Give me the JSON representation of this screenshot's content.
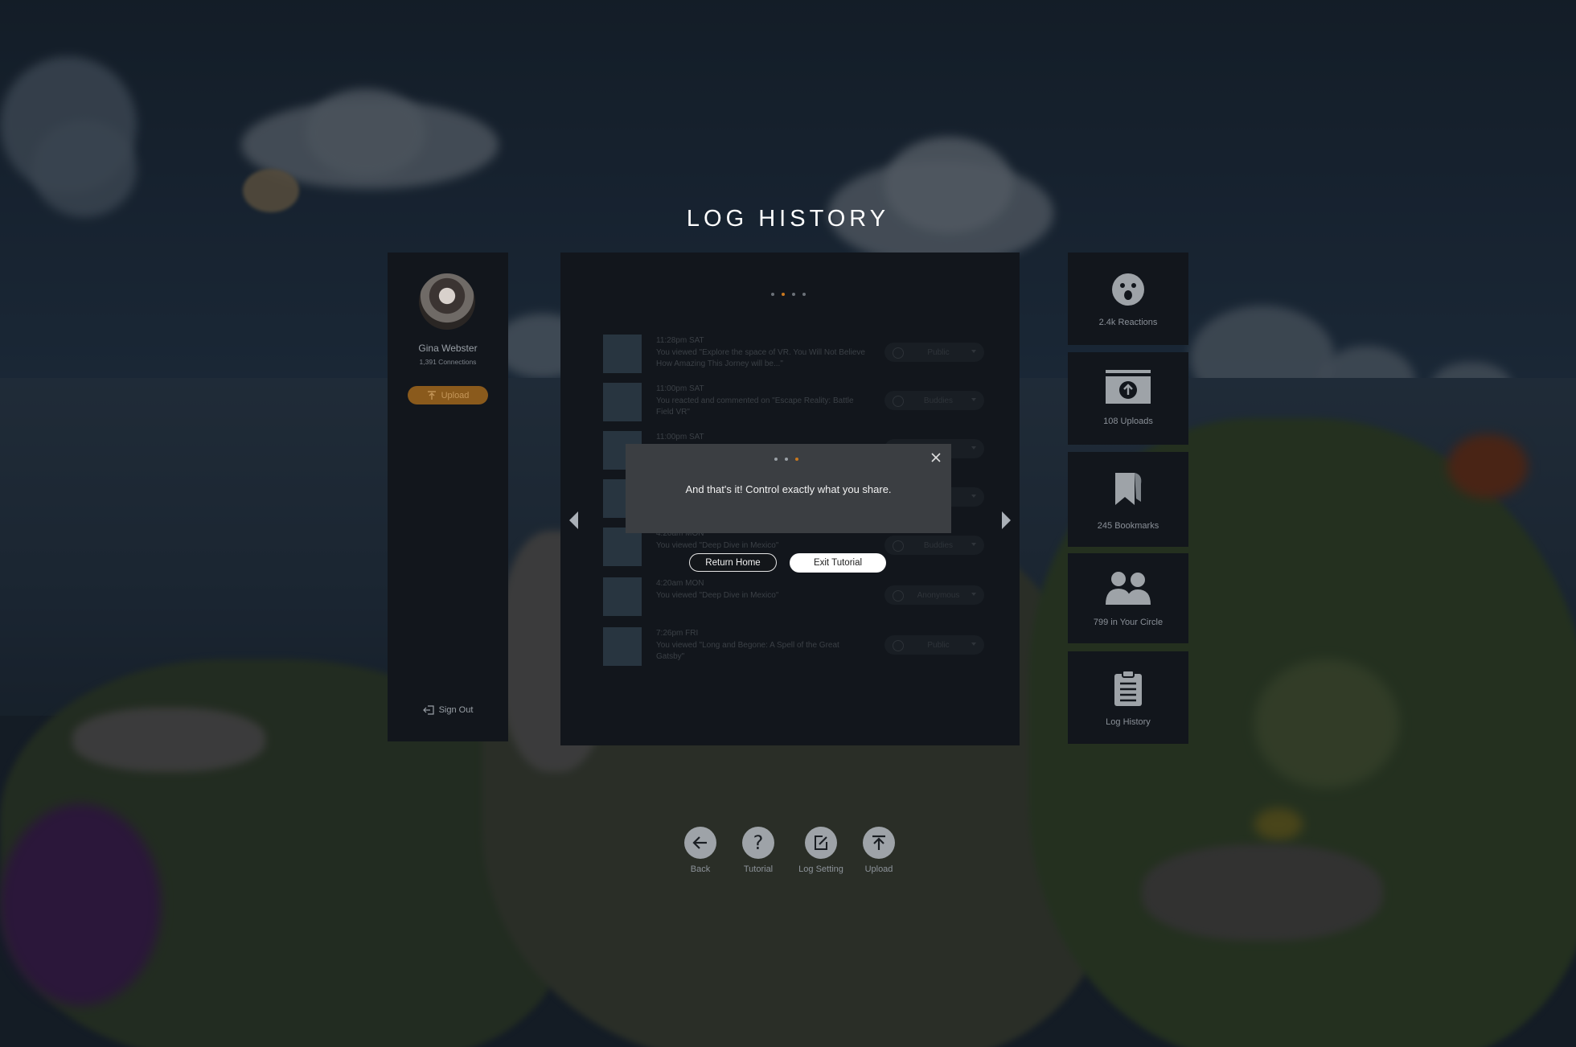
{
  "title": "LOG HISTORY",
  "profile": {
    "name": "Gina Webster",
    "connections": "1,391 Connections",
    "upload_label": "Upload",
    "signout_label": "Sign Out"
  },
  "log_entries": [
    {
      "time": "11:28pm SAT",
      "text": "You viewed \"Explore the space of VR. You Will Not Believe How Amazing This Jorney will be...\"",
      "privacy": "Public"
    },
    {
      "time": "11:00pm SAT",
      "text": "You reacted and commented on \"Escape Reality: Battle Field VR\"",
      "privacy": "Buddies"
    },
    {
      "time": "11:00pm SAT",
      "text": "",
      "privacy": "...us"
    },
    {
      "time": "",
      "text": "",
      "privacy": ""
    },
    {
      "time": "4:20am MON",
      "text": "You viewed \"Deep Dive in Mexico\"",
      "privacy": "Buddies"
    },
    {
      "time": "4:20am MON",
      "text": "You viewed \"Deep Dive in Mexico\"",
      "privacy": "Anonymous"
    },
    {
      "time": "7:26pm FRI",
      "text": "You viewed \"Long and Begone: A Spell of the Great Gatsby\"",
      "privacy": "Public"
    }
  ],
  "tutorial": {
    "message": "And that's it! Control exactly what you share.",
    "return_label": "Return Home",
    "exit_label": "Exit Tutorial",
    "step_total": 3,
    "step_current": 3
  },
  "panel_page": {
    "total": 4,
    "current": 2
  },
  "stats": [
    {
      "label": "2.4k Reactions",
      "icon": "reaction-face-icon"
    },
    {
      "label": "108 Uploads",
      "icon": "upload-box-icon"
    },
    {
      "label": "245 Bookmarks",
      "icon": "bookmark-icon"
    },
    {
      "label": "799 in Your Circle",
      "icon": "people-icon"
    },
    {
      "label": "Log History",
      "icon": "clipboard-icon"
    }
  ],
  "toolbar": {
    "back_label": "Back",
    "tutorial_label": "Tutorial",
    "log_setting_label": "Log Setting",
    "upload_label": "Upload"
  },
  "colors": {
    "accent": "#c9781e",
    "panel": "#12161c",
    "dialog": "#3b3e42"
  }
}
